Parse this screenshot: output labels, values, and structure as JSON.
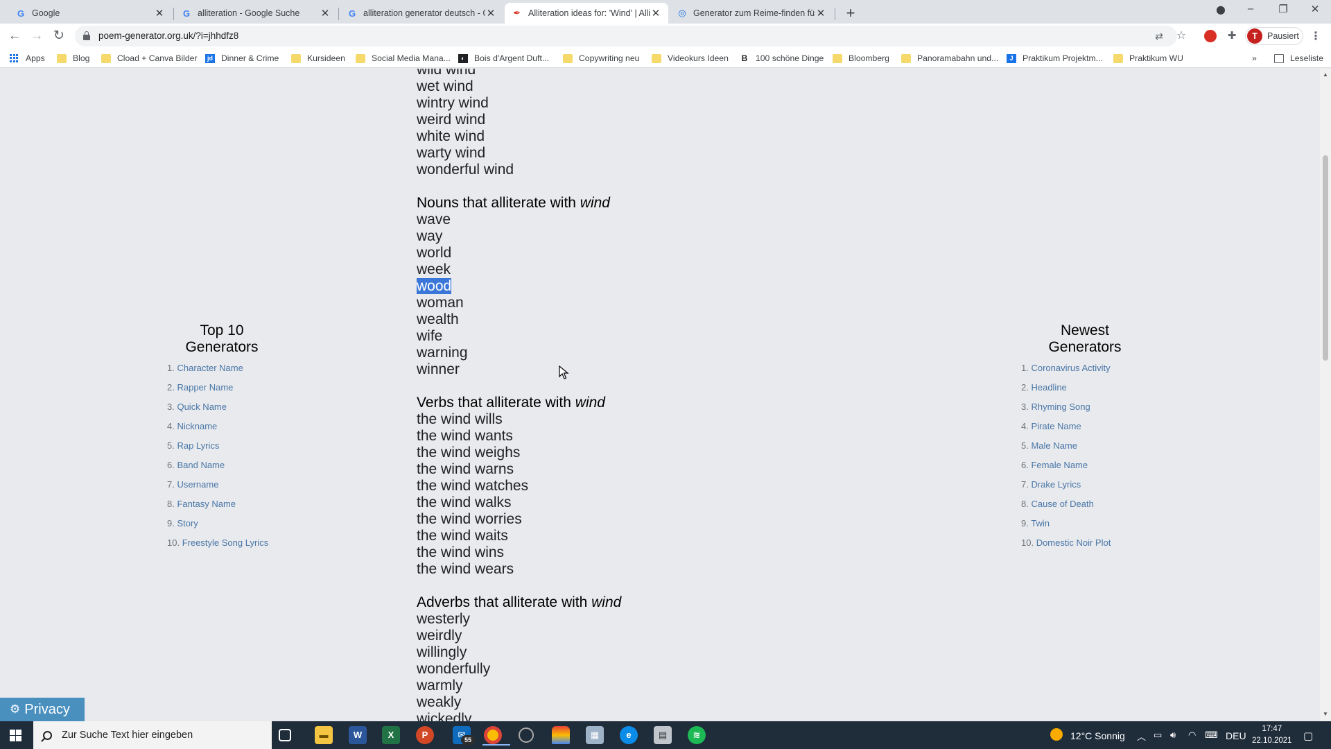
{
  "browser": {
    "tabs": [
      {
        "title": "Google",
        "active": false
      },
      {
        "title": "alliteration - Google Suche",
        "active": false
      },
      {
        "title": "alliteration generator deutsch - G",
        "active": false
      },
      {
        "title": "Alliteration ideas for: 'Wind' | Alli",
        "active": true
      },
      {
        "title": "Generator zum Reime-finden für",
        "active": false
      }
    ],
    "url": "poem-generator.org.uk/?i=jhhdfz8",
    "profile_label": "Pausiert",
    "profile_initial": "T",
    "bookmarks": [
      "Apps",
      "Blog",
      "Cload + Canva Bilder",
      "Dinner & Crime",
      "Kursideen",
      "Social Media Mana...",
      "Bois d'Argent Duft...",
      "Copywriting neu",
      "Videokurs Ideen",
      "100 schöne Dinge",
      "Bloomberg",
      "Panoramabahn und...",
      "Praktikum Projektm...",
      "Praktikum WU"
    ],
    "reading_list": "Leseliste"
  },
  "content": {
    "keyword": "wind",
    "adjectives_tail": [
      "wild wind",
      "wet wind",
      "wintry wind",
      "weird wind",
      "white wind",
      "warty wind",
      "wonderful wind"
    ],
    "nouns_heading_prefix": "Nouns that alliterate with ",
    "nouns": [
      "wave",
      "way",
      "world",
      "week",
      "wood",
      "woman",
      "wealth",
      "wife",
      "warning",
      "winner"
    ],
    "selected_noun": "wood",
    "verbs_heading_prefix": "Verbs that alliterate with ",
    "verbs": [
      "the wind wills",
      "the wind wants",
      "the wind weighs",
      "the wind warns",
      "the wind watches",
      "the wind walks",
      "the wind worries",
      "the wind waits",
      "the wind wins",
      "the wind wears"
    ],
    "adverbs_heading_prefix": "Adverbs that alliterate with ",
    "adverbs": [
      "westerly",
      "weirdly",
      "willingly",
      "wonderfully",
      "warmly",
      "weakly",
      "wickedly"
    ]
  },
  "sidebar_left": {
    "title_line1": "Top 10",
    "title_line2": "Generators",
    "items": [
      "Character Name",
      "Rapper Name",
      "Quick Name",
      "Nickname",
      "Rap Lyrics",
      "Band Name",
      "Username",
      "Fantasy Name",
      "Story",
      "Freestyle Song Lyrics"
    ]
  },
  "sidebar_right": {
    "title_line1": "Newest",
    "title_line2": "Generators",
    "items": [
      "Coronavirus Activity",
      "Headline",
      "Rhyming Song",
      "Pirate Name",
      "Male Name",
      "Female Name",
      "Drake Lyrics",
      "Cause of Death",
      "Twin",
      "Domestic Noir Plot"
    ]
  },
  "privacy_label": "Privacy",
  "taskbar": {
    "search_placeholder": "Zur Suche Text hier eingeben",
    "mail_badge": "55",
    "weather": "12°C  Sonnig",
    "language": "DEU",
    "time": "17:47",
    "date": "22.10.2021"
  }
}
